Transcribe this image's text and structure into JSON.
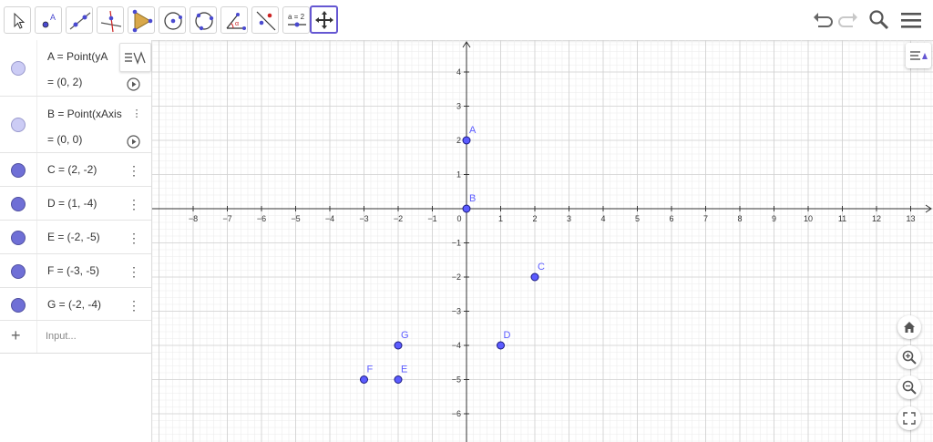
{
  "algebra": {
    "items": [
      {
        "name": "A",
        "line1": "A = Point(yA",
        "line2": "= (0, 2)",
        "style": "hollow"
      },
      {
        "name": "B",
        "line1": "B = Point(xAxis",
        "line2": "= (0, 0)",
        "style": "hollow"
      },
      {
        "name": "C",
        "line1": "C = (2, -2)",
        "style": "filled"
      },
      {
        "name": "D",
        "line1": "D = (1, -4)",
        "style": "filled"
      },
      {
        "name": "E",
        "line1": "E = (-2, -5)",
        "style": "filled"
      },
      {
        "name": "F",
        "line1": "F = (-3, -5)",
        "style": "filled"
      },
      {
        "name": "G",
        "line1": "G = (-2, -4)",
        "style": "filled"
      }
    ],
    "input_placeholder": "Input...",
    "add_symbol": "+"
  },
  "toolbar": {
    "tools": [
      "move",
      "point",
      "line",
      "perpendicular-line",
      "polygon",
      "circle-center-point",
      "circle-three-points",
      "angle",
      "reflect-about-line",
      "slider",
      "move-graphics-view"
    ],
    "slider_label": "a = 2",
    "selected_tool": "move-graphics-view"
  },
  "graphics": {
    "x_ticks": [
      -8,
      -7,
      -6,
      -5,
      -4,
      -3,
      -2,
      -1,
      0,
      1,
      2,
      3,
      4,
      5,
      6,
      7,
      8,
      9,
      10,
      11,
      12,
      13
    ],
    "y_ticks": [
      4,
      3,
      2,
      1,
      -1,
      -2,
      -3,
      -4,
      -5,
      -6
    ],
    "origin_label": "0",
    "point_color": "#5c5cff",
    "points": [
      {
        "label": "A",
        "x": 0,
        "y": 2
      },
      {
        "label": "B",
        "x": 0,
        "y": 0
      },
      {
        "label": "C",
        "x": 2,
        "y": -2
      },
      {
        "label": "D",
        "x": 1,
        "y": -4
      },
      {
        "label": "E",
        "x": -2,
        "y": -5
      },
      {
        "label": "F",
        "x": -3,
        "y": -5
      },
      {
        "label": "G",
        "x": -2,
        "y": -4
      }
    ]
  },
  "colors": {
    "accent": "#6557d2",
    "grid_minor": "#ececec",
    "grid_major": "#d0d0d0"
  }
}
